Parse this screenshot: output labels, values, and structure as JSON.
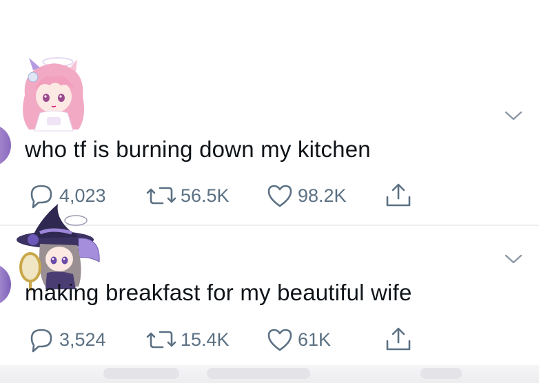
{
  "tweets": [
    {
      "text": "who tf is burning down my kitchen",
      "replies": "4,023",
      "retweets": "56.5K",
      "likes": "98.2K"
    },
    {
      "text": "making breakfast for my beautiful wife",
      "replies": "3,524",
      "retweets": "15.4K",
      "likes": "61K"
    }
  ],
  "icons": {
    "reply": "speech-bubble-icon",
    "retweet": "retweet-arrows-icon",
    "like": "heart-icon",
    "share": "share-upload-icon",
    "more": "chevron-down-icon"
  },
  "colors": {
    "text": "#0f1419",
    "muted": "#5b7083",
    "divider": "#eceef0"
  }
}
